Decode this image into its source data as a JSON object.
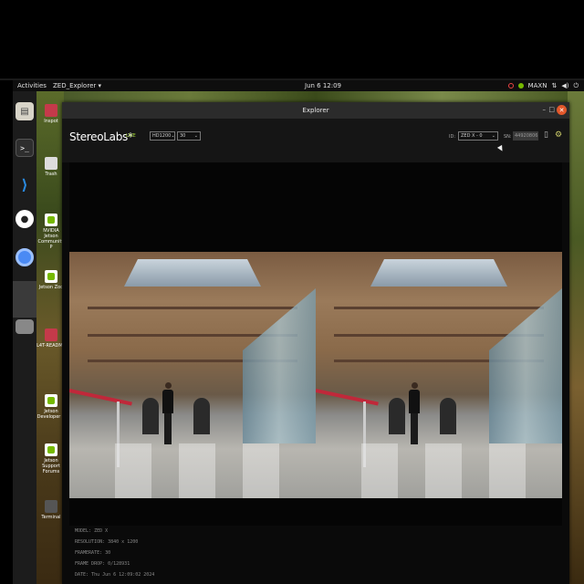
{
  "topbar": {
    "activities": "Activities",
    "app_menu": "ZED_Explorer ▾",
    "clock": "Jun 6 12:09",
    "power_mode": "MAXN"
  },
  "dock": {
    "items": [
      "files-icon",
      "terminal-icon",
      "vscode-icon",
      "obs-icon",
      "chromium-icon",
      "zed-explorer-icon",
      "drive-icon"
    ]
  },
  "desktop": {
    "icons": [
      {
        "label": "Inspot",
        "icon": "nvidia-icon"
      },
      {
        "label": "Trash",
        "icon": "trash-icon"
      },
      {
        "label": "NVIDIA Jetson Community P",
        "icon": "nvidia-icon"
      },
      {
        "label": "Jetson Zoo",
        "icon": "nvidia-icon"
      },
      {
        "label": "L4T-README",
        "icon": "drive-icon"
      },
      {
        "label": "Jetson Developer Z",
        "icon": "nvidia-icon"
      },
      {
        "label": "Jetson Support Forums",
        "icon": "nvidia-icon"
      },
      {
        "label": "Terminal",
        "icon": "terminal-icon"
      }
    ]
  },
  "window": {
    "title": "Explorer",
    "minimize": "–",
    "maximize": "□",
    "close": "✕"
  },
  "app": {
    "logo": "StereoLabs*",
    "live_badge": "LIVE",
    "resolution_select": "HD1200",
    "fps_select": "30",
    "id_label": "ID:",
    "id_select": "ZED X - 0",
    "sn_label": "SN:",
    "sn_value": "44920806"
  },
  "info": {
    "model": "MODEL: ZED X",
    "resolution": "RESOLUTION: 3840 x 1200",
    "framerate": "FRAMERATE: 30",
    "frame_drop": "FRAME DROP: 0/128931",
    "date": "DATE: Thu Jun 6 12:09:02 2024"
  },
  "colors": {
    "accent_green": "#76b900",
    "close_button": "#e2572a",
    "live_badge": "#9acd32"
  }
}
